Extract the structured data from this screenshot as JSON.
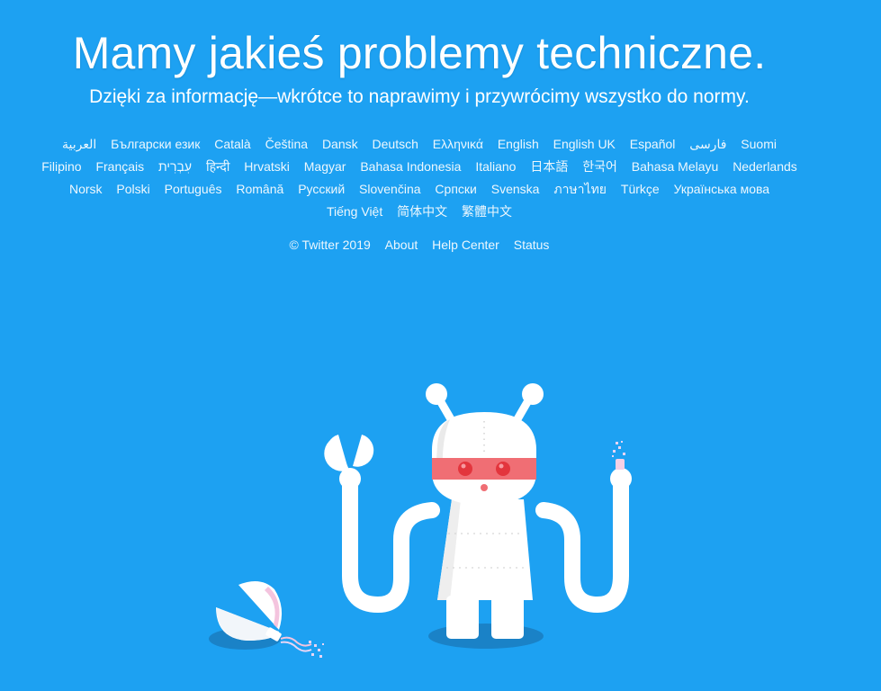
{
  "header": {
    "title": "Mamy jakieś problemy techniczne.",
    "subtitle": "Dzięki za informację—wkrótce to naprawimy i przywrócimy wszystko do normy."
  },
  "languages": [
    "العربية",
    "Български език",
    "Català",
    "Čeština",
    "Dansk",
    "Deutsch",
    "Ελληνικά",
    "English",
    "English UK",
    "Español",
    "فارسی",
    "Suomi",
    "Filipino",
    "Français",
    "עִבְרִית",
    "हिन्दी",
    "Hrvatski",
    "Magyar",
    "Bahasa Indonesia",
    "Italiano",
    "日本語",
    "한국어",
    "Bahasa Melayu",
    "Nederlands",
    "Norsk",
    "Polski",
    "Português",
    "Română",
    "Русский",
    "Slovenčina",
    "Српски",
    "Svenska",
    "ภาษาไทย",
    "Türkçe",
    "Українська мова",
    "Tiếng Việt",
    "简体中文",
    "繁體中文"
  ],
  "footer": {
    "copyright": "© Twitter 2019",
    "about": "About",
    "help_center": "Help Center",
    "status": "Status"
  },
  "illustration": {
    "icon": "broken-robot-illustration",
    "colors": {
      "background": "#1DA1F2",
      "robot_body": "#ffffff",
      "visor": "#F06E74",
      "shadow": "#1A82C7"
    }
  }
}
